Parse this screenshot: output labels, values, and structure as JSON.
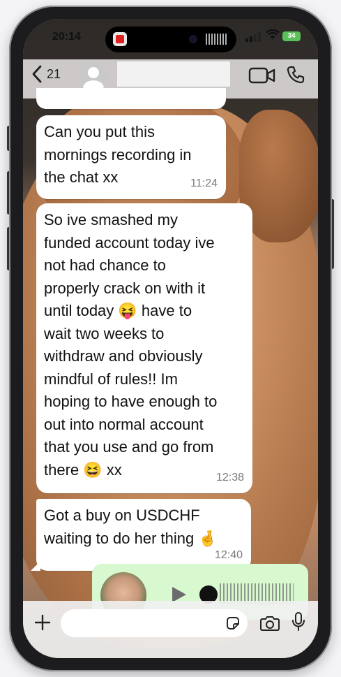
{
  "status_bar": {
    "time": "20:14",
    "battery": "34"
  },
  "header": {
    "back_count": "21",
    "contact_name": ""
  },
  "messages": [
    {
      "text": "",
      "time": ""
    },
    {
      "text": "Can you put this\nmornings recording in\nthe chat xx",
      "time": "11:24"
    },
    {
      "text": "So ive smashed my\nfunded account today ive\nnot had chance to\nproperly crack on with it\nuntil today 😝 have to\nwait two weeks to\nwithdraw and obviously\nmindful of rules!! Im\nhoping to have enough to\nout into normal account\nthat you use and go from\nthere 😆 xx",
      "time": "12:38"
    },
    {
      "text": "Got a buy on USDCHF\nwaiting to do her thing 🤞",
      "time": "12:40"
    }
  ],
  "input": {
    "placeholder": ""
  },
  "icons": {
    "back": "chevron-left-icon",
    "video": "video-camera-icon",
    "call": "phone-icon",
    "attach": "plus-icon",
    "sticker": "sticker-icon",
    "camera": "camera-icon",
    "mic": "microphone-icon",
    "play": "play-icon"
  },
  "colors": {
    "incoming_bubble": "#ffffff",
    "outgoing_bubble": "#d8f8cf",
    "battery": "#5ac05a"
  }
}
